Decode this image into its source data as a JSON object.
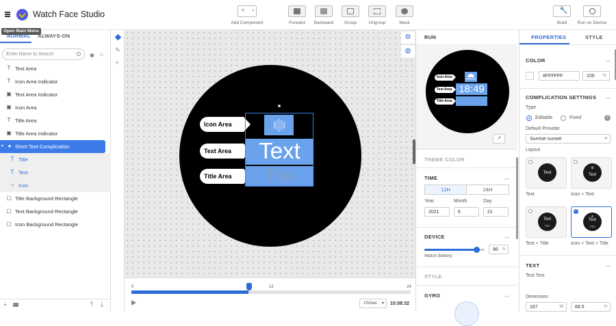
{
  "app": {
    "title": "Watch Face Studio",
    "tooltip": "Open Main Menu"
  },
  "toolbar": {
    "add_component": "Add Component",
    "forward": "Forward",
    "backward": "Backward",
    "group": "Group",
    "ungroup": "Ungroup",
    "mask": "Mask",
    "build": "Build",
    "run_on_device": "Run on Device"
  },
  "left": {
    "tabs": [
      "NORMAL",
      "ALWAYS-ON"
    ],
    "search_placeholder": "Enter Name to Search",
    "layers": [
      {
        "label": "Text Area",
        "icon": "text-icon"
      },
      {
        "label": "Icon Area Indicator",
        "icon": "text-icon"
      },
      {
        "label": "Text Area Indicator",
        "icon": "image-icon"
      },
      {
        "label": "Icon Area",
        "icon": "image-icon"
      },
      {
        "label": "Title Area",
        "icon": "text-icon"
      },
      {
        "label": "Title Area Indicator",
        "icon": "image-icon"
      },
      {
        "label": "Short Text Complication",
        "icon": "complication-icon"
      },
      {
        "label": "Title",
        "icon": "text-icon"
      },
      {
        "label": "Text",
        "icon": "text-icon"
      },
      {
        "label": "Icon",
        "icon": "circle-icon"
      },
      {
        "label": "Title Background Rectangle",
        "icon": "rect-icon"
      },
      {
        "label": "Text Background Rectangle",
        "icon": "rect-icon"
      },
      {
        "label": "Icon Background  Rectangle",
        "icon": "rect-icon"
      }
    ]
  },
  "canvas": {
    "labels": [
      "Icon Area",
      "Text Area",
      "Title Area"
    ],
    "text_preview": "Text",
    "title_preview": "Title"
  },
  "timeline": {
    "ticks": [
      "0",
      "12",
      "24"
    ],
    "speed": "1S/sec",
    "time": "10:08:32"
  },
  "run": {
    "title": "RUN",
    "preview_time": "18:49",
    "mini_labels": [
      "Icon Area",
      "Text Area",
      "Title Area"
    ],
    "theme_color": "THEME COLOR",
    "time_section": "TIME",
    "h12": "12H",
    "h24": "24H",
    "year_label": "Year",
    "month_label": "Month",
    "day_label": "Day",
    "year": "2021",
    "month": "6",
    "day": "21",
    "device_section": "DEVICE",
    "watch_battery": "Watch Battery",
    "battery_value": "86",
    "battery_unit": "%",
    "battery_fraction": 0.86,
    "style_section": "STYLE",
    "gyro_section": "GYRO"
  },
  "props": {
    "tabs": [
      "PROPERTIES",
      "STYLE"
    ],
    "color_section": "COLOR",
    "color_hex": "#FFFFFF",
    "opacity": "100",
    "opacity_unit": "%",
    "comp_settings": "COMPLICATION SETTINGS",
    "type_label": "Type",
    "editable": "Editable",
    "fixed": "Fixed",
    "default_provider_label": "Default Provider",
    "default_provider": "Sunrise sunset",
    "layout_label": "Layout",
    "layouts": [
      "Text",
      "Icon + Text",
      "Text + Title",
      "Icon + Text + Title"
    ],
    "card_text": "Text",
    "card_title": "Title",
    "text_section": "TEXT",
    "test_text_label": "Test Text",
    "dimension_label": "Dimension",
    "dim_w": "167",
    "dim_w_unit": "W",
    "dim_h": "68.5",
    "dim_h_unit": "H"
  },
  "colors": {
    "accent": "#2d6bd6",
    "selection": "#3d7ce8",
    "complication_blue": "#6aa3ec"
  }
}
